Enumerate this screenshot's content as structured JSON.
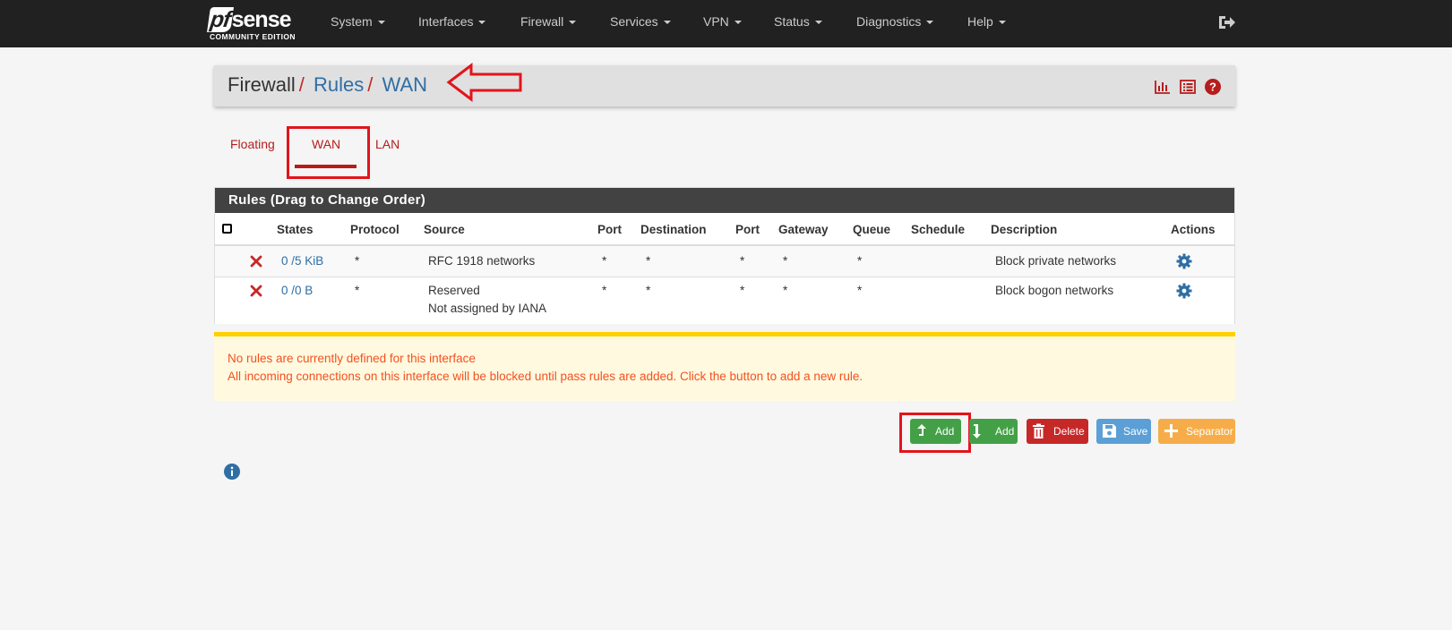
{
  "brand": {
    "name": "sense",
    "mark": "pf",
    "subtitle": "COMMUNITY EDITION"
  },
  "nav": {
    "items": [
      "System",
      "Interfaces",
      "Firewall",
      "Services",
      "VPN",
      "Status",
      "Diagnostics",
      "Help"
    ],
    "logout_icon": "sign-out-icon"
  },
  "breadcrumb": {
    "root": "Firewall",
    "middle": "Rules",
    "current": "WAN",
    "sep": "/"
  },
  "header_icons": [
    "bar-chart-icon",
    "list-icon",
    "question-circle-icon"
  ],
  "tabs": [
    {
      "label": "Floating",
      "active": false
    },
    {
      "label": "WAN",
      "active": true
    },
    {
      "label": "LAN",
      "active": false
    }
  ],
  "rules_panel": {
    "title": "Rules (Drag to Change Order)",
    "columns": [
      "States",
      "Protocol",
      "Source",
      "Port",
      "Destination",
      "Port",
      "Gateway",
      "Queue",
      "Schedule",
      "Description",
      "Actions"
    ],
    "rows": [
      {
        "states": "0 /5 KiB",
        "protocol": "*",
        "source": "RFC 1918 networks",
        "source2": "",
        "port": "*",
        "destination": "*",
        "dport": "*",
        "gateway": "*",
        "queue": "*",
        "schedule": "",
        "description": "Block private networks"
      },
      {
        "states": "0 /0 B",
        "protocol": "*",
        "source": "Reserved",
        "source2": "Not assigned by IANA",
        "port": "*",
        "destination": "*",
        "dport": "*",
        "gateway": "*",
        "queue": "*",
        "schedule": "",
        "description": "Block bogon networks"
      }
    ]
  },
  "warning": {
    "line1": "No rules are currently defined for this interface",
    "line2": "All incoming connections on this interface will be blocked until pass rules are added. Click the button to add a new rule."
  },
  "buttons": {
    "add_top": "Add",
    "add_bottom": "Add",
    "delete": "Delete",
    "save": "Save",
    "separator": "Separator"
  },
  "colors": {
    "navbar": "#212121",
    "accent_red": "#b71c1c",
    "link_blue": "#2f6ea5",
    "success": "#43a047",
    "danger": "#c62828",
    "info": "#5c9fd6",
    "warning": "#f6ad49",
    "annotation": "#e2141c"
  }
}
